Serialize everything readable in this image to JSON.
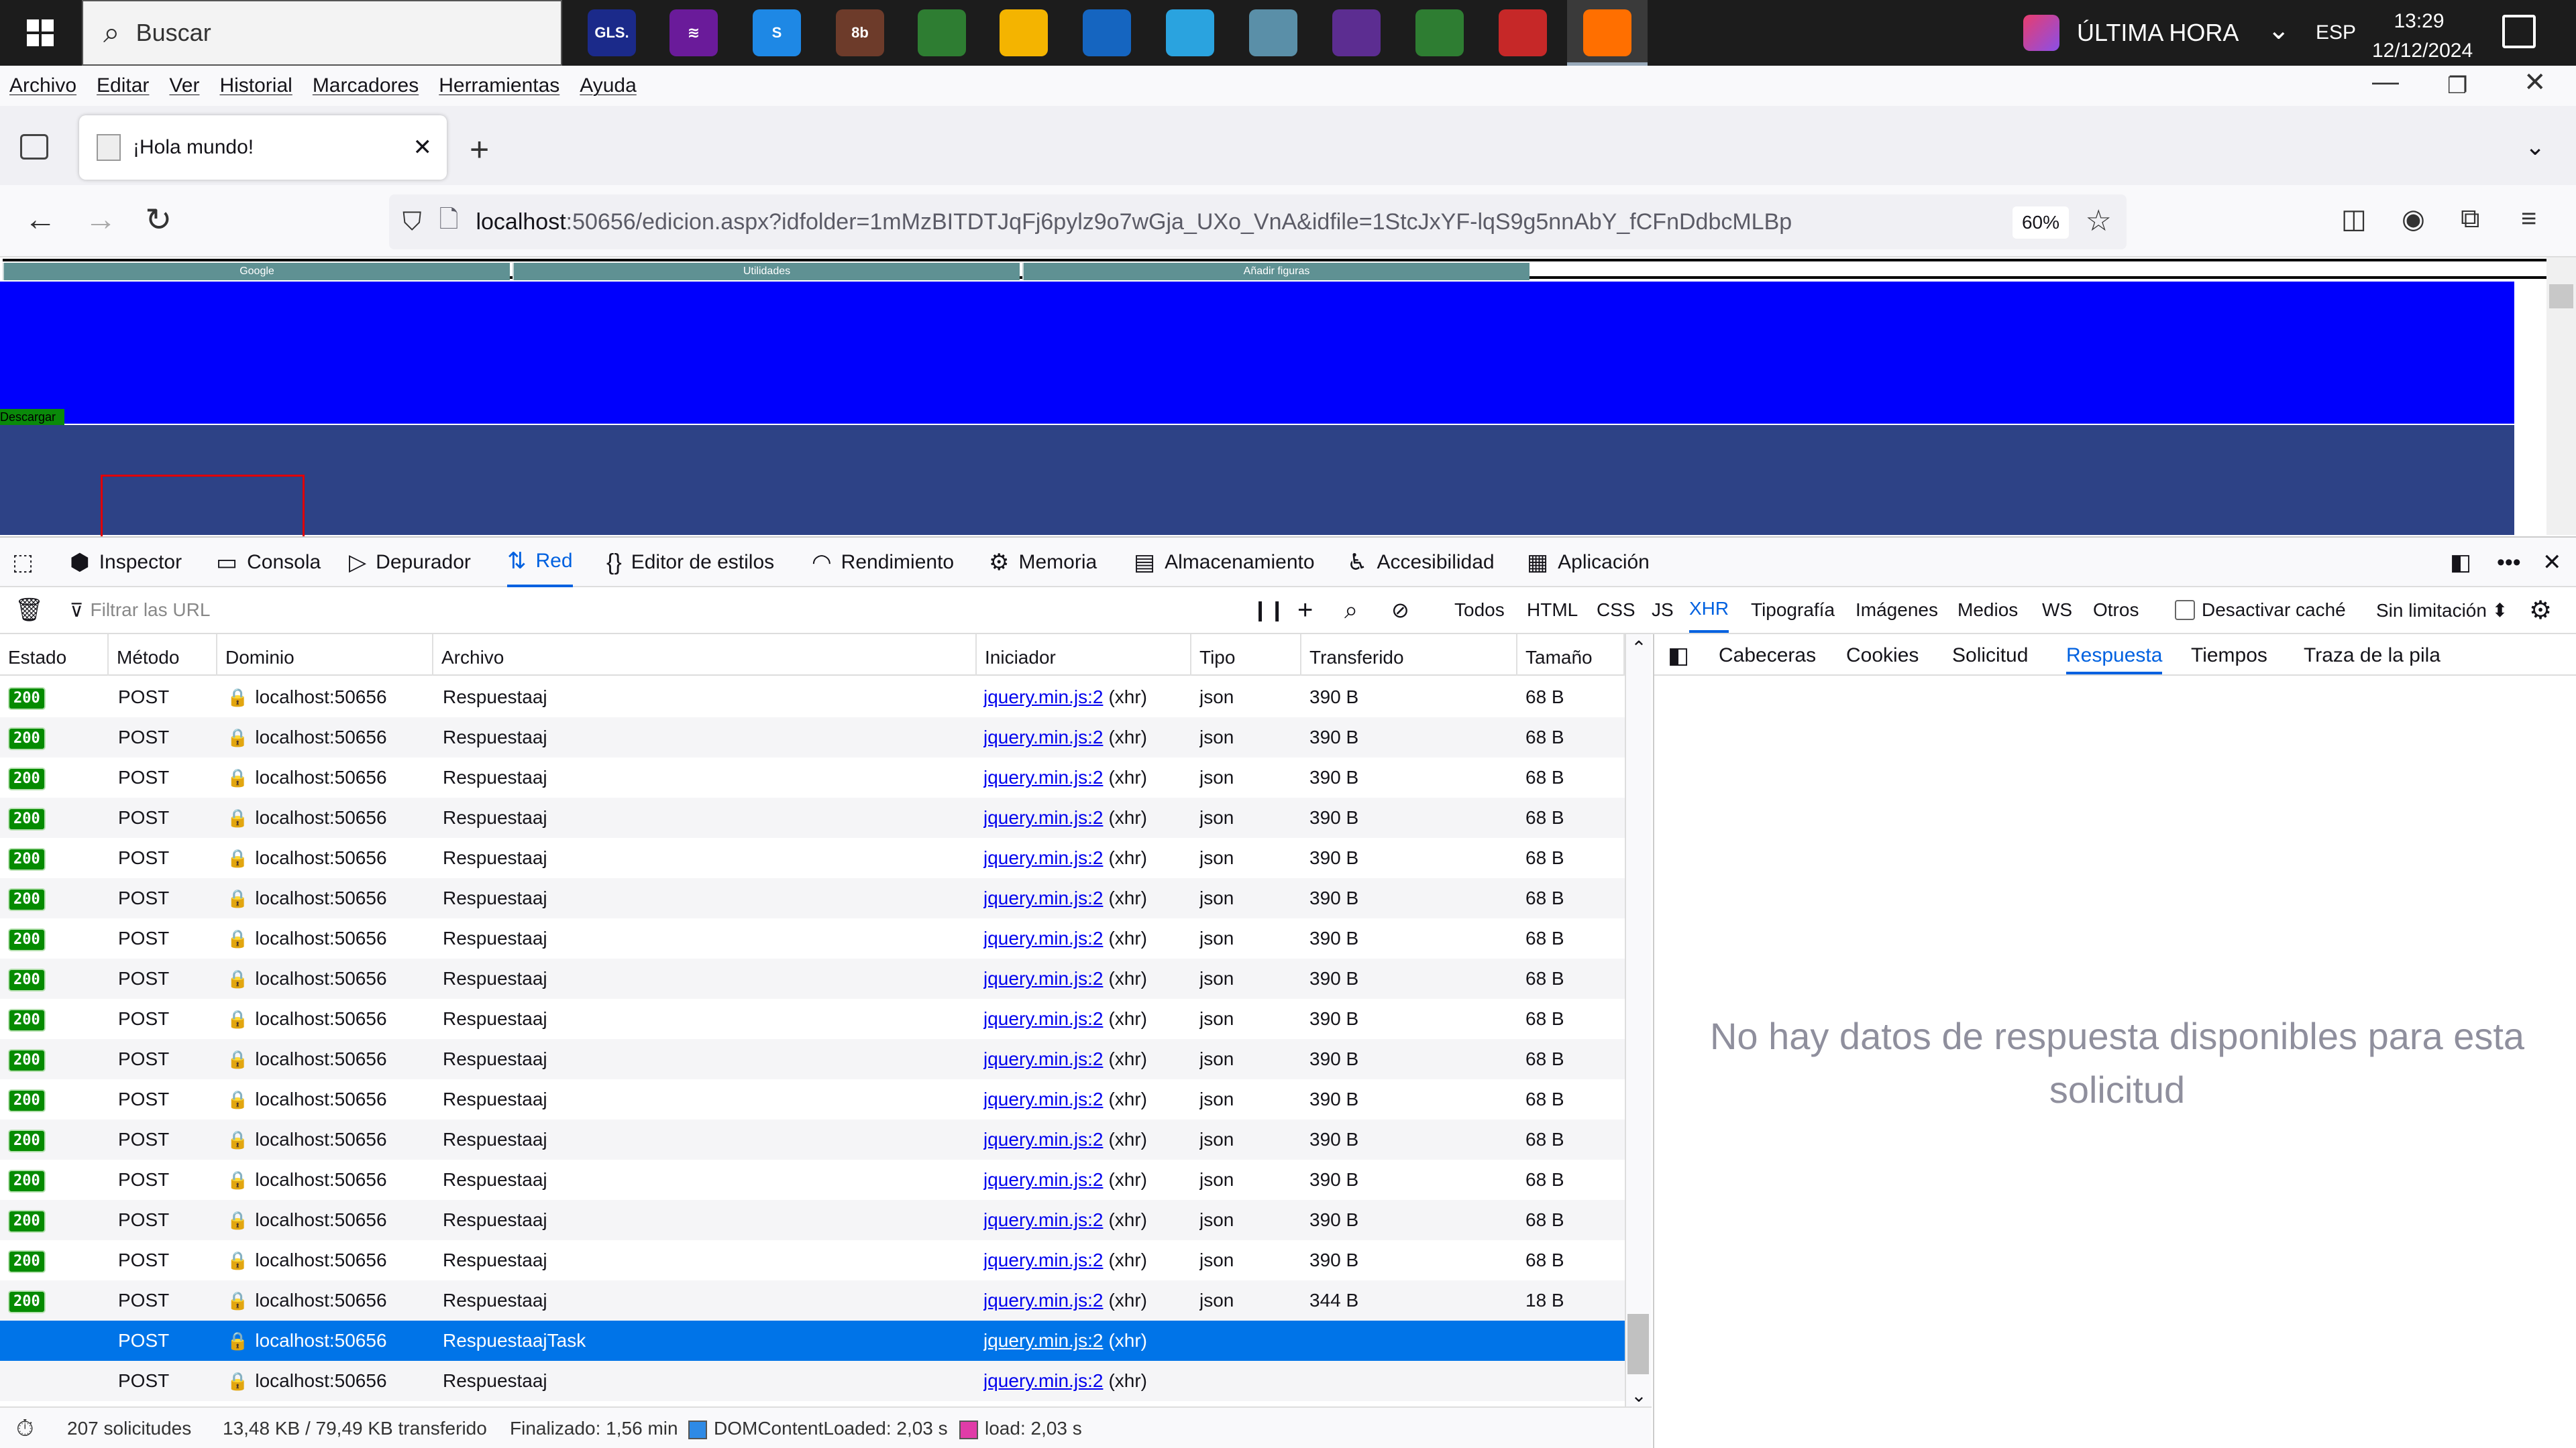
{
  "taskbar": {
    "search_placeholder": "Buscar",
    "apps": [
      {
        "name": "gls-app",
        "label": "GLS.",
        "color": "#1b2a8a"
      },
      {
        "name": "purple-app",
        "label": "≋",
        "color": "#6a1b9a"
      },
      {
        "name": "s-app",
        "label": "S",
        "color": "#1e88e5"
      },
      {
        "name": "toolbox-app",
        "label": "8b",
        "color": "#6d3b2a"
      },
      {
        "name": "chrome-app",
        "label": "",
        "color": "#2e7d32"
      },
      {
        "name": "explorer-app",
        "label": "",
        "color": "#f4b400"
      },
      {
        "name": "thunderbird-app",
        "label": "",
        "color": "#1565c0"
      },
      {
        "name": "telegram-app",
        "label": "",
        "color": "#2aa3df"
      },
      {
        "name": "notes-app",
        "label": "",
        "color": "#5a8fa8"
      },
      {
        "name": "visualstudio-app",
        "label": "",
        "color": "#5c2d91"
      },
      {
        "name": "chrome-profile-app",
        "label": "",
        "color": "#2e7d32"
      },
      {
        "name": "chrome-profile2-app",
        "label": "",
        "color": "#c62828"
      },
      {
        "name": "firefox-app",
        "label": "",
        "color": "#ff6f00"
      }
    ],
    "news": "ÚLTIMA HORA",
    "lang": "ESP",
    "time": "13:29",
    "date": "12/12/2024"
  },
  "menu": [
    "Archivo",
    "Editar",
    "Ver",
    "Historial",
    "Marcadores",
    "Herramientas",
    "Ayuda"
  ],
  "tab": {
    "title": "¡Hola mundo!"
  },
  "url": {
    "host": "localhost",
    "rest": ":50656/edicion.aspx?idfolder=1mMzBITDTJqFj6pylz9o7wGja_UXo_VnA&idfile=1StcJxYF-lqS9g5nnAbY_fCFnDdbcMLBp",
    "zoom": "60%"
  },
  "page": {
    "tabs": [
      "Google",
      "Utilidades",
      "Añadir figuras"
    ],
    "download": "Descargar"
  },
  "devtools": {
    "tools": [
      "Inspector",
      "Consola",
      "Depurador",
      "Red",
      "Editor de estilos",
      "Rendimiento",
      "Memoria",
      "Almacenamiento",
      "Accesibilidad",
      "Aplicación"
    ],
    "filter_placeholder": "Filtrar las URL",
    "types": [
      "Todos",
      "HTML",
      "CSS",
      "JS",
      "XHR",
      "Tipografía",
      "Imágenes",
      "Medios",
      "WS",
      "Otros"
    ],
    "disable_cache": "Desactivar caché",
    "throttle": "Sin limitación ⬍",
    "columns": [
      "Estado",
      "Método",
      "Dominio",
      "Archivo",
      "Iniciador",
      "Tipo",
      "Transferido",
      "Tamaño"
    ],
    "rows": [
      {
        "status": "200",
        "method": "POST",
        "domain": "localhost:50656",
        "file": "Respuestaaj",
        "init": "jquery.min.js:2",
        "init_suffix": "(xhr)",
        "type": "json",
        "transferred": "390 B",
        "size": "68 B"
      },
      {
        "status": "200",
        "method": "POST",
        "domain": "localhost:50656",
        "file": "Respuestaaj",
        "init": "jquery.min.js:2",
        "init_suffix": "(xhr)",
        "type": "json",
        "transferred": "390 B",
        "size": "68 B"
      },
      {
        "status": "200",
        "method": "POST",
        "domain": "localhost:50656",
        "file": "Respuestaaj",
        "init": "jquery.min.js:2",
        "init_suffix": "(xhr)",
        "type": "json",
        "transferred": "390 B",
        "size": "68 B"
      },
      {
        "status": "200",
        "method": "POST",
        "domain": "localhost:50656",
        "file": "Respuestaaj",
        "init": "jquery.min.js:2",
        "init_suffix": "(xhr)",
        "type": "json",
        "transferred": "390 B",
        "size": "68 B"
      },
      {
        "status": "200",
        "method": "POST",
        "domain": "localhost:50656",
        "file": "Respuestaaj",
        "init": "jquery.min.js:2",
        "init_suffix": "(xhr)",
        "type": "json",
        "transferred": "390 B",
        "size": "68 B"
      },
      {
        "status": "200",
        "method": "POST",
        "domain": "localhost:50656",
        "file": "Respuestaaj",
        "init": "jquery.min.js:2",
        "init_suffix": "(xhr)",
        "type": "json",
        "transferred": "390 B",
        "size": "68 B"
      },
      {
        "status": "200",
        "method": "POST",
        "domain": "localhost:50656",
        "file": "Respuestaaj",
        "init": "jquery.min.js:2",
        "init_suffix": "(xhr)",
        "type": "json",
        "transferred": "390 B",
        "size": "68 B"
      },
      {
        "status": "200",
        "method": "POST",
        "domain": "localhost:50656",
        "file": "Respuestaaj",
        "init": "jquery.min.js:2",
        "init_suffix": "(xhr)",
        "type": "json",
        "transferred": "390 B",
        "size": "68 B"
      },
      {
        "status": "200",
        "method": "POST",
        "domain": "localhost:50656",
        "file": "Respuestaaj",
        "init": "jquery.min.js:2",
        "init_suffix": "(xhr)",
        "type": "json",
        "transferred": "390 B",
        "size": "68 B"
      },
      {
        "status": "200",
        "method": "POST",
        "domain": "localhost:50656",
        "file": "Respuestaaj",
        "init": "jquery.min.js:2",
        "init_suffix": "(xhr)",
        "type": "json",
        "transferred": "390 B",
        "size": "68 B"
      },
      {
        "status": "200",
        "method": "POST",
        "domain": "localhost:50656",
        "file": "Respuestaaj",
        "init": "jquery.min.js:2",
        "init_suffix": "(xhr)",
        "type": "json",
        "transferred": "390 B",
        "size": "68 B"
      },
      {
        "status": "200",
        "method": "POST",
        "domain": "localhost:50656",
        "file": "Respuestaaj",
        "init": "jquery.min.js:2",
        "init_suffix": "(xhr)",
        "type": "json",
        "transferred": "390 B",
        "size": "68 B"
      },
      {
        "status": "200",
        "method": "POST",
        "domain": "localhost:50656",
        "file": "Respuestaaj",
        "init": "jquery.min.js:2",
        "init_suffix": "(xhr)",
        "type": "json",
        "transferred": "390 B",
        "size": "68 B"
      },
      {
        "status": "200",
        "method": "POST",
        "domain": "localhost:50656",
        "file": "Respuestaaj",
        "init": "jquery.min.js:2",
        "init_suffix": "(xhr)",
        "type": "json",
        "transferred": "390 B",
        "size": "68 B"
      },
      {
        "status": "200",
        "method": "POST",
        "domain": "localhost:50656",
        "file": "Respuestaaj",
        "init": "jquery.min.js:2",
        "init_suffix": "(xhr)",
        "type": "json",
        "transferred": "390 B",
        "size": "68 B"
      },
      {
        "status": "200",
        "method": "POST",
        "domain": "localhost:50656",
        "file": "Respuestaaj",
        "init": "jquery.min.js:2",
        "init_suffix": "(xhr)",
        "type": "json",
        "transferred": "344 B",
        "size": "18 B"
      },
      {
        "status": "",
        "method": "POST",
        "domain": "localhost:50656",
        "file": "RespuestaajTask",
        "init": "jquery.min.js:2",
        "init_suffix": "(xhr)",
        "type": "",
        "transferred": "",
        "size": "",
        "selected": true
      },
      {
        "status": "",
        "method": "POST",
        "domain": "localhost:50656",
        "file": "Respuestaaj",
        "init": "jquery.min.js:2",
        "init_suffix": "(xhr)",
        "type": "",
        "transferred": "",
        "size": ""
      }
    ],
    "side_tabs": [
      "Cabeceras",
      "Cookies",
      "Solicitud",
      "Respuesta",
      "Tiempos",
      "Traza de la pila"
    ],
    "no_response": "No hay datos de respuesta disponibles para esta solicitud",
    "status": {
      "requests": "207 solicitudes",
      "transferred": "13,48 KB / 79,49 KB transferido",
      "finished": "Finalizado: 1,56 min",
      "dcl": "DOMContentLoaded: 2,03 s",
      "load": "load: 2,03 s"
    }
  },
  "colors": {
    "accent": "#0061e0",
    "selected_row": "#0074e8",
    "status_ok": "#058b00",
    "banner": "#0000fd",
    "canvas": "#2d4286"
  }
}
